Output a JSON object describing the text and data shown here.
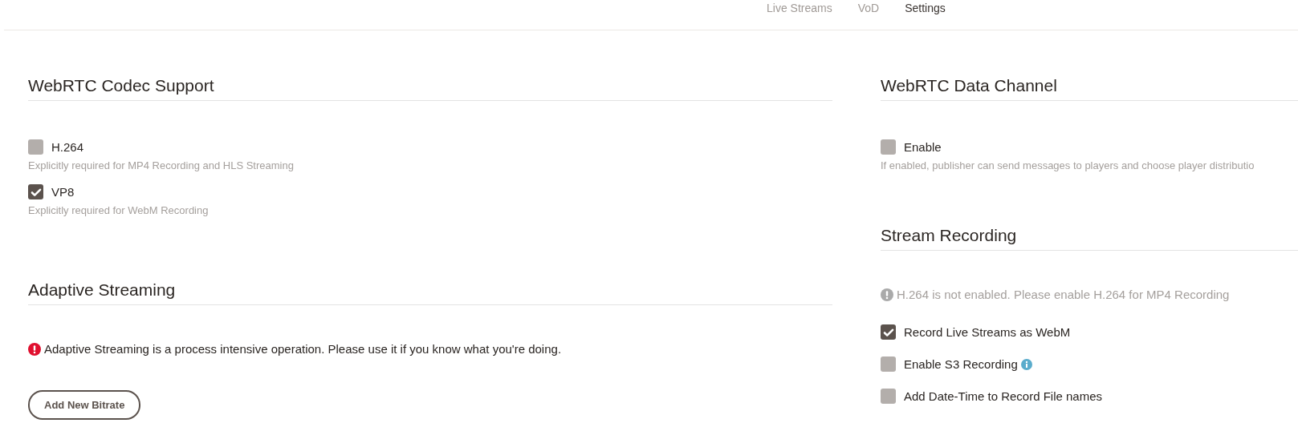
{
  "nav": [
    {
      "label": "Live Streams",
      "selected": false
    },
    {
      "label": "VoD",
      "selected": false
    },
    {
      "label": "Settings",
      "selected": true
    }
  ],
  "columns": [
    {
      "sections": [
        {
          "title": "WebRTC Codec Support",
          "items": [
            {
              "kind": "checkbox",
              "label": "H.264",
              "checked": false,
              "info": false,
              "hint": "Explicitly required for MP4 Recording and HLS Streaming"
            },
            {
              "kind": "checkbox",
              "label": "VP8",
              "checked": true,
              "info": false,
              "hint": "Explicitly required for WebM Recording"
            }
          ]
        },
        {
          "title": "Adaptive Streaming",
          "items": [
            {
              "kind": "error",
              "text": "Adaptive Streaming is a process intensive operation. Please use it if you know what you're doing."
            },
            {
              "kind": "button",
              "label": "Add New Bitrate"
            }
          ]
        }
      ]
    },
    {
      "sections": [
        {
          "title": "WebRTC Data Channel",
          "items": [
            {
              "kind": "checkbox",
              "label": "Enable",
              "checked": false,
              "info": false,
              "hint": "If enabled, publisher can send messages to players and choose player distributio"
            }
          ]
        },
        {
          "title": "Stream Recording",
          "items": [
            {
              "kind": "notice",
              "text": "H.264 is not enabled. Please enable H.264 for MP4 Recording"
            },
            {
              "kind": "checkbox",
              "label": "Record Live Streams as WebM",
              "checked": true,
              "info": false
            },
            {
              "kind": "checkbox",
              "label": "Enable S3 Recording",
              "checked": false,
              "info": true
            },
            {
              "kind": "checkbox",
              "label": "Add Date-Time to Record File names",
              "checked": false,
              "info": false
            }
          ]
        }
      ]
    }
  ]
}
